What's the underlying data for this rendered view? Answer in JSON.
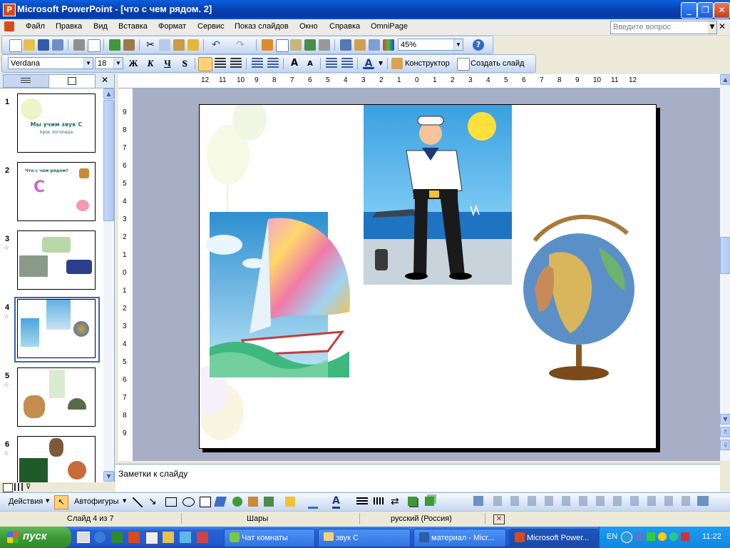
{
  "window": {
    "title": "Microsoft PowerPoint - [что с чем рядом. 2]",
    "controls": [
      "minimize",
      "maximize",
      "close"
    ]
  },
  "menubar": {
    "items": [
      "Файл",
      "Правка",
      "Вид",
      "Вставка",
      "Формат",
      "Сервис",
      "Показ слайдов",
      "Окно",
      "Справка",
      "OmniPage"
    ],
    "help_placeholder": "Введите вопрос"
  },
  "standard_toolbar": {
    "zoom": "45%"
  },
  "formatting_toolbar": {
    "font": "Verdana",
    "font_size": "18",
    "bold": "Ж",
    "italic": "К",
    "underline": "Ч",
    "shadow": "S",
    "designer": "Конструктор",
    "new_slide": "Создать слайд"
  },
  "ruler": {
    "labels": [
      "12",
      "11",
      "10",
      "9",
      "8",
      "7",
      "6",
      "5",
      "4",
      "3",
      "2",
      "1",
      "0",
      "1",
      "2",
      "3",
      "4",
      "5",
      "6",
      "7",
      "8",
      "9",
      "10",
      "11",
      "12"
    ],
    "vlabels": [
      "9",
      "8",
      "7",
      "6",
      "5",
      "4",
      "3",
      "2",
      "1",
      "0",
      "1",
      "2",
      "3",
      "4",
      "5",
      "6",
      "7",
      "8",
      "9"
    ]
  },
  "slides_pane": {
    "thumbs": [
      {
        "num": "1",
        "title": "Мы учим звук С",
        "subtitle": "Урок логопеда"
      },
      {
        "num": "2",
        "title": "Что с чем рядом?",
        "letter": "С"
      },
      {
        "num": "3"
      },
      {
        "num": "4"
      },
      {
        "num": "5"
      },
      {
        "num": "6"
      }
    ]
  },
  "notes": {
    "placeholder": "Заметки к слайду"
  },
  "drawing_toolbar": {
    "actions": "Действия",
    "autoshapes": "Автофигуры"
  },
  "statusbar": {
    "slide": "Слайд 4 из 7",
    "design": "Шары",
    "language": "русский (Россия)"
  },
  "taskbar": {
    "start": "пуск",
    "tasks": [
      "Чат комнаты",
      "звук С",
      "материал - Micr...",
      "Microsoft Power..."
    ],
    "lang": "EN",
    "clock": "11:22"
  },
  "colors": {
    "title_bar": "#0842b4",
    "taskbar": "#2460d6",
    "start_button": "#3c9b35",
    "workspace": "#a7afc7",
    "toolbar": "#c3d6f2"
  }
}
